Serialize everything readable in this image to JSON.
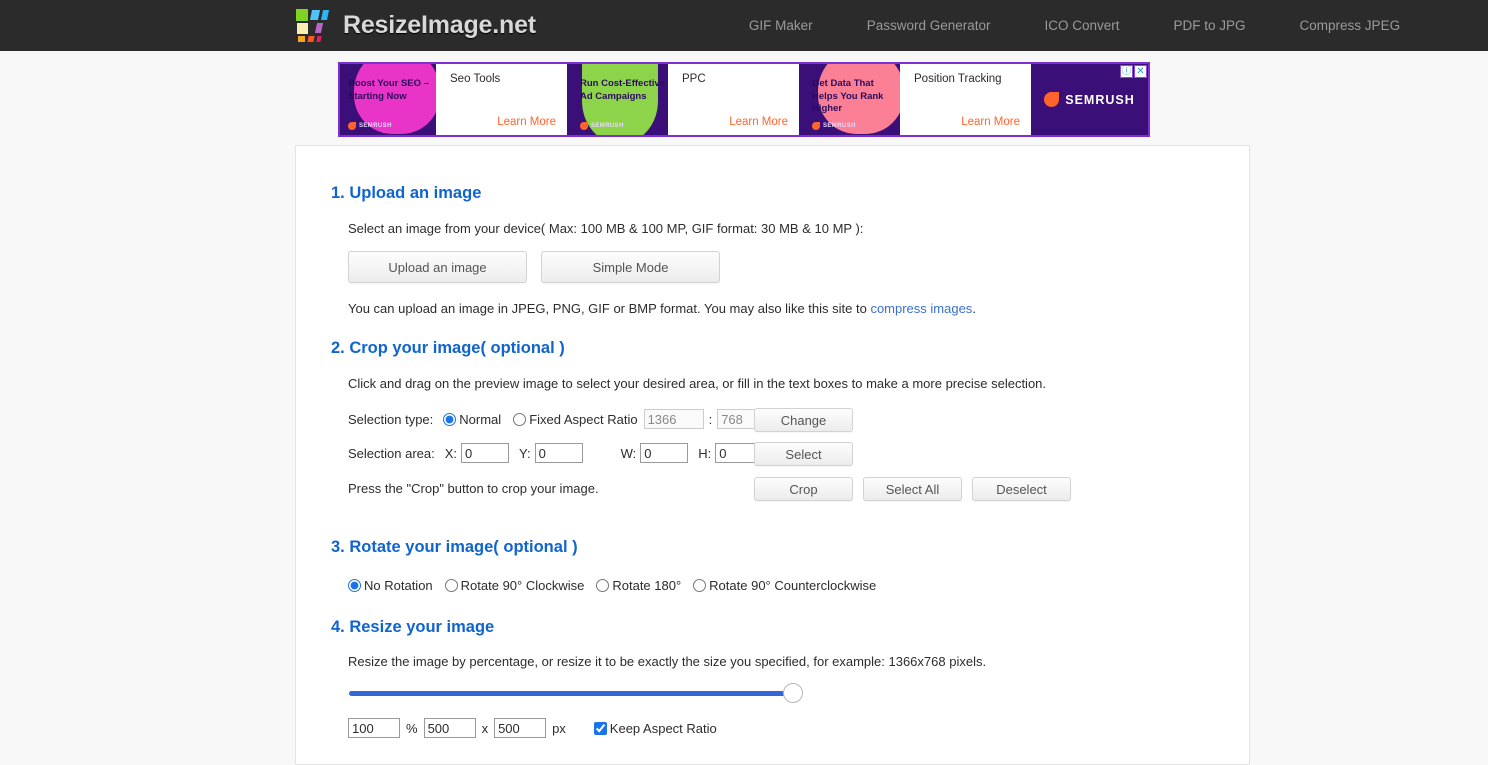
{
  "header": {
    "brand": "ResizeImage.net",
    "logo_icon": "colored-squares-logo",
    "nav": [
      {
        "label": "GIF Maker"
      },
      {
        "label": "Password Generator"
      },
      {
        "label": "ICO Convert"
      },
      {
        "label": "PDF to JPG"
      },
      {
        "label": "Compress JPEG"
      }
    ]
  },
  "ad": {
    "brand": "SEMRUSH",
    "info_icon": "info-icon",
    "close_icon": "close-icon",
    "panels": [
      {
        "headline": "Boost Your SEO – Starting Now",
        "title": "Seo Tools",
        "cta": "Learn More",
        "blob": "magenta"
      },
      {
        "headline": "Run Cost-Effective Ad Campaigns",
        "title": "PPC",
        "cta": "Learn More",
        "blob": "green"
      },
      {
        "headline": "Get Data That Helps You Rank Higher",
        "title": "Position Tracking",
        "cta": "Learn More",
        "blob": "pink"
      }
    ]
  },
  "sections": {
    "upload": {
      "heading": "1. Upload an image",
      "description": "Select an image from your device( Max: 100 MB & 100 MP, GIF format: 30 MB & 10 MP ):",
      "upload_button": "Upload an image",
      "simple_mode_button": "Simple Mode",
      "note_prefix": "You can upload an image in JPEG, PNG, GIF or BMP format. You may also like this site to ",
      "note_link": "compress images",
      "note_suffix": "."
    },
    "crop": {
      "heading": "2. Crop your image( optional )",
      "description": "Click and drag on the preview image to select your desired area, or fill in the text boxes to make a more precise selection.",
      "selection_type_label": "Selection type:",
      "normal_label": "Normal",
      "fixed_ratio_label": "Fixed Aspect Ratio",
      "ratio_width": "1366",
      "ratio_height": "768",
      "ratio_separator": ":",
      "change_button": "Change",
      "selection_area_label": "Selection area:",
      "x_label": "X:",
      "x_value": "0",
      "y_label": "Y:",
      "y_value": "0",
      "w_label": "W:",
      "w_value": "0",
      "h_label": "H:",
      "h_value": "0",
      "select_button": "Select",
      "press_note": "Press the \"Crop\" button to crop your image.",
      "crop_button": "Crop",
      "select_all_button": "Select All",
      "deselect_button": "Deselect"
    },
    "rotate": {
      "heading": "3. Rotate your image( optional )",
      "options": [
        {
          "label": "No Rotation",
          "selected": true
        },
        {
          "label": "Rotate 90° Clockwise",
          "selected": false
        },
        {
          "label": "Rotate 180°",
          "selected": false
        },
        {
          "label": "Rotate 90° Counterclockwise",
          "selected": false
        }
      ]
    },
    "resize": {
      "heading": "4. Resize your image",
      "description": "Resize the image by percentage, or resize it to be exactly the size you specified, for example: 1366x768 pixels.",
      "slider_value": "100",
      "percent_value": "100",
      "percent_unit": "%",
      "width_value": "500",
      "times": "x",
      "height_value": "500",
      "px_unit": "px",
      "keep_aspect_label": "Keep Aspect Ratio",
      "keep_aspect_checked": true
    }
  },
  "colors": {
    "header_bg": "#2b2b2b",
    "heading_blue": "#1064cf",
    "link_blue": "#3a6fd1",
    "slider_blue": "#3367d6",
    "ad_purple": "#3b0f78",
    "ad_orange": "#ff642d",
    "page_bg": "#f8f8f8"
  }
}
